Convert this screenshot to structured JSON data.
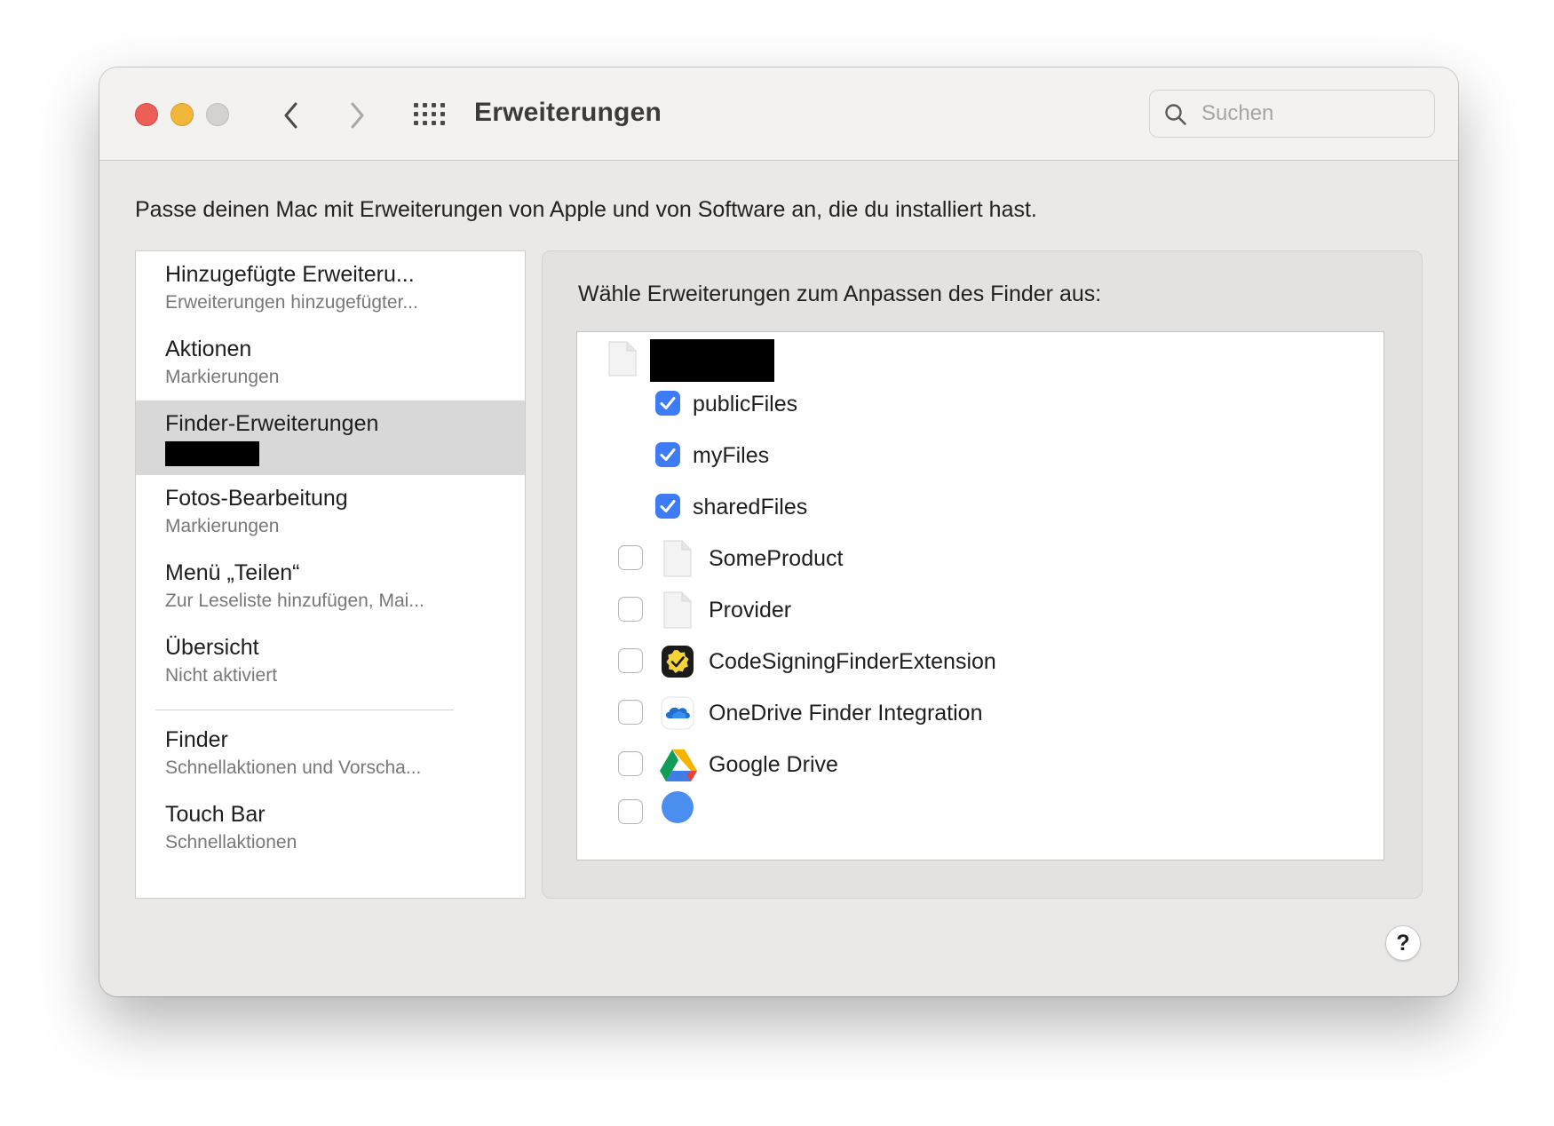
{
  "window": {
    "title": "Erweiterungen",
    "search": {
      "placeholder": "Suchen",
      "value": ""
    }
  },
  "description": "Passe deinen Mac mit Erweiterungen von Apple und von Software an, die du installiert hast.",
  "sidebar": {
    "items": [
      {
        "name": "Hinzugefügte Erweiteru...",
        "sub": "Erweiterungen hinzugefügter..."
      },
      {
        "name": "Aktionen",
        "sub": "Markierungen"
      },
      {
        "name": "Finder-Erweiterungen",
        "sub": "",
        "redacted": true,
        "selected": true
      },
      {
        "name": "Fotos-Bearbeitung",
        "sub": "Markierungen"
      },
      {
        "name": "Menü „Teilen“",
        "sub": "Zur Leseliste hinzufügen, Mai..."
      },
      {
        "name": "Übersicht",
        "sub": "Nicht aktiviert"
      },
      {
        "name": "Finder",
        "sub": "Schnellaktionen und Vorscha..."
      },
      {
        "name": "Touch Bar",
        "sub": "Schnellaktionen"
      }
    ]
  },
  "panel": {
    "label": "Wähle Erweiterungen zum Anpassen des Finder aus:",
    "group": {
      "redacted": true,
      "icon": "document-icon"
    },
    "sub_items": [
      {
        "label": "publicFiles",
        "checked": true
      },
      {
        "label": "myFiles",
        "checked": true
      },
      {
        "label": "sharedFiles",
        "checked": true
      }
    ],
    "items": [
      {
        "label": "SomeProduct",
        "checked": false,
        "icon": "document-icon"
      },
      {
        "label": "Provider",
        "checked": false,
        "icon": "document-icon"
      },
      {
        "label": "CodeSigningFinderExtension",
        "checked": false,
        "icon": "codesigning-badge-icon"
      },
      {
        "label": "OneDrive Finder Integration",
        "checked": false,
        "icon": "onedrive-cloud-icon"
      },
      {
        "label": "Google Drive",
        "checked": false,
        "icon": "google-drive-icon"
      }
    ]
  },
  "help": {
    "label": "?"
  },
  "colors": {
    "checkbox_on": "#3d7bf7",
    "selection": "#d9d8d8",
    "close": "#ec5f57",
    "minimize": "#f1b63a",
    "zoom": "#d4d2d1"
  }
}
